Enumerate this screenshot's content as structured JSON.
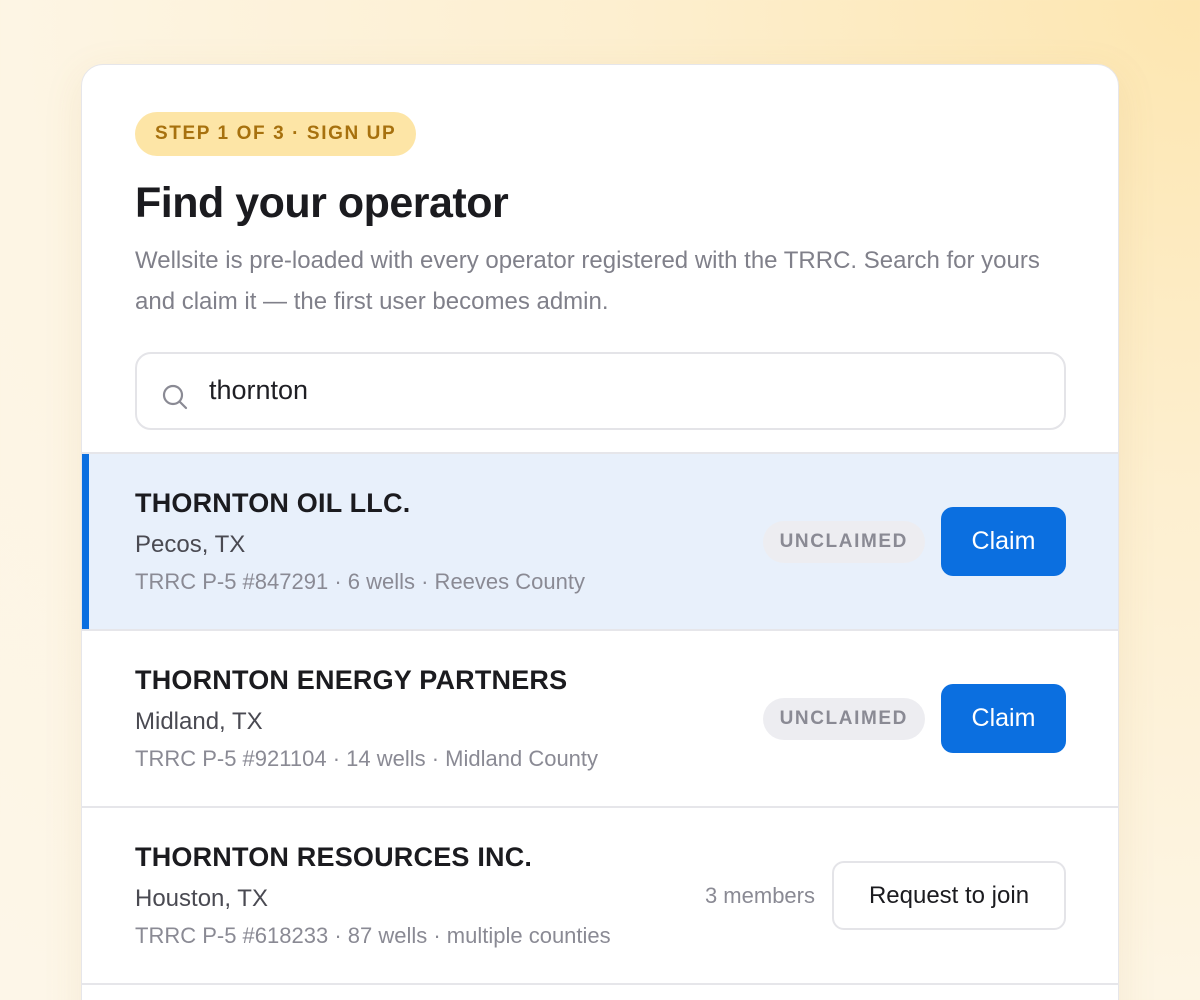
{
  "header": {
    "step_badge": "STEP 1 OF 3 · SIGN UP",
    "title": "Find your operator",
    "subtitle": "Wellsite is pre-loaded with every operator registered with the TRRC. Search for yours and claim it — the first user becomes admin."
  },
  "search": {
    "icon": "search-icon",
    "value": "thornton"
  },
  "results": [
    {
      "name": "THORNTON OIL LLC.",
      "location": "Pecos, TX",
      "meta": "TRRC P-5 #847291 · 6 wells · Reeves County",
      "status": "UNCLAIMED",
      "action": "Claim",
      "selected": true
    },
    {
      "name": "THORNTON ENERGY PARTNERS",
      "location": "Midland, TX",
      "meta": "TRRC P-5 #921104 · 14 wells · Midland County",
      "status": "UNCLAIMED",
      "action": "Claim",
      "selected": false
    },
    {
      "name": "THORNTON RESOURCES INC.",
      "location": "Houston, TX",
      "meta": "TRRC P-5 #618233 · 87 wells · multiple counties",
      "members": "3 members",
      "action": "Request to join",
      "selected": false
    }
  ],
  "colors": {
    "accent": "#0b6fe0",
    "badge_bg": "#fde5a6",
    "badge_text": "#a7710e",
    "selected_row_bg": "#e8f0fb"
  }
}
